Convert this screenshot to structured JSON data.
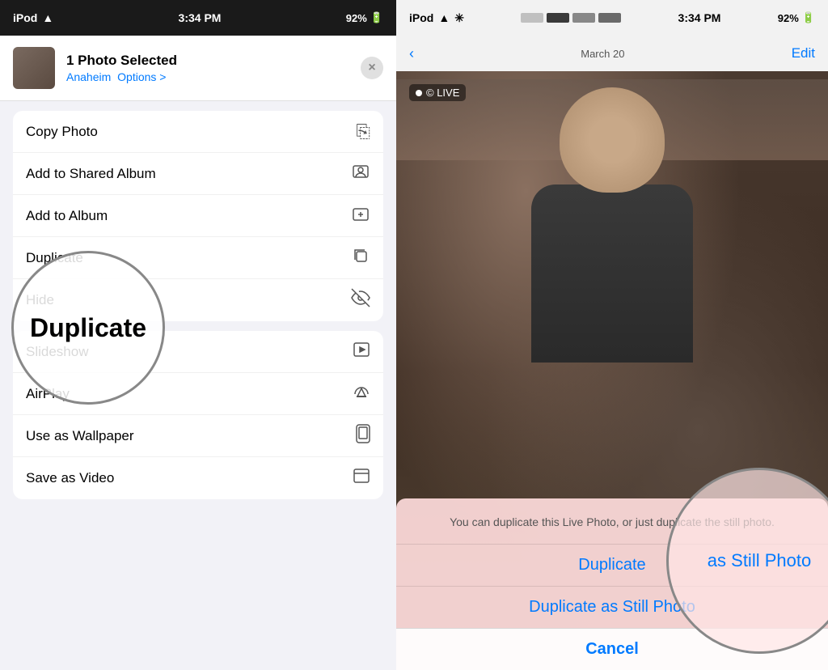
{
  "left": {
    "status_bar": {
      "carrier": "iPod",
      "wifi_icon": "📶",
      "time": "3:34 PM",
      "battery": "92%"
    },
    "header": {
      "title": "1 Photo Selected",
      "subtitle": "Anaheim",
      "options_label": "Options >",
      "close_label": "×"
    },
    "menu_items": [
      {
        "label": "Copy Photo",
        "icon": "⎘"
      },
      {
        "label": "Add to Shared Album",
        "icon": "☁"
      },
      {
        "label": "Add to Album",
        "icon": "+"
      },
      {
        "label": "Duplicate",
        "icon": "❐"
      },
      {
        "label": "Hide",
        "icon": "👁"
      },
      {
        "label": "Slideshow",
        "icon": "▶"
      },
      {
        "label": "AirPlay",
        "icon": "⬆"
      },
      {
        "label": "Use as Wallpaper",
        "icon": "📱"
      },
      {
        "label": "Save as Video",
        "icon": "☐"
      }
    ],
    "circle_highlight": {
      "text": "Duplicate"
    }
  },
  "right": {
    "status_bar": {
      "carrier": "iPod",
      "time": "3:34 PM",
      "battery": "92%"
    },
    "nav": {
      "back_icon": "‹",
      "title": "March 20",
      "edit_label": "Edit"
    },
    "live_badge": "© LIVE",
    "bottom_sheet": {
      "message": "You can duplicate this Live Photo, or just duplicate the still photo.",
      "btn1": "Duplicate",
      "btn2": "Duplicate as Still Photo",
      "btn3": "Cancel"
    },
    "circle_text": "as Still Photo"
  }
}
